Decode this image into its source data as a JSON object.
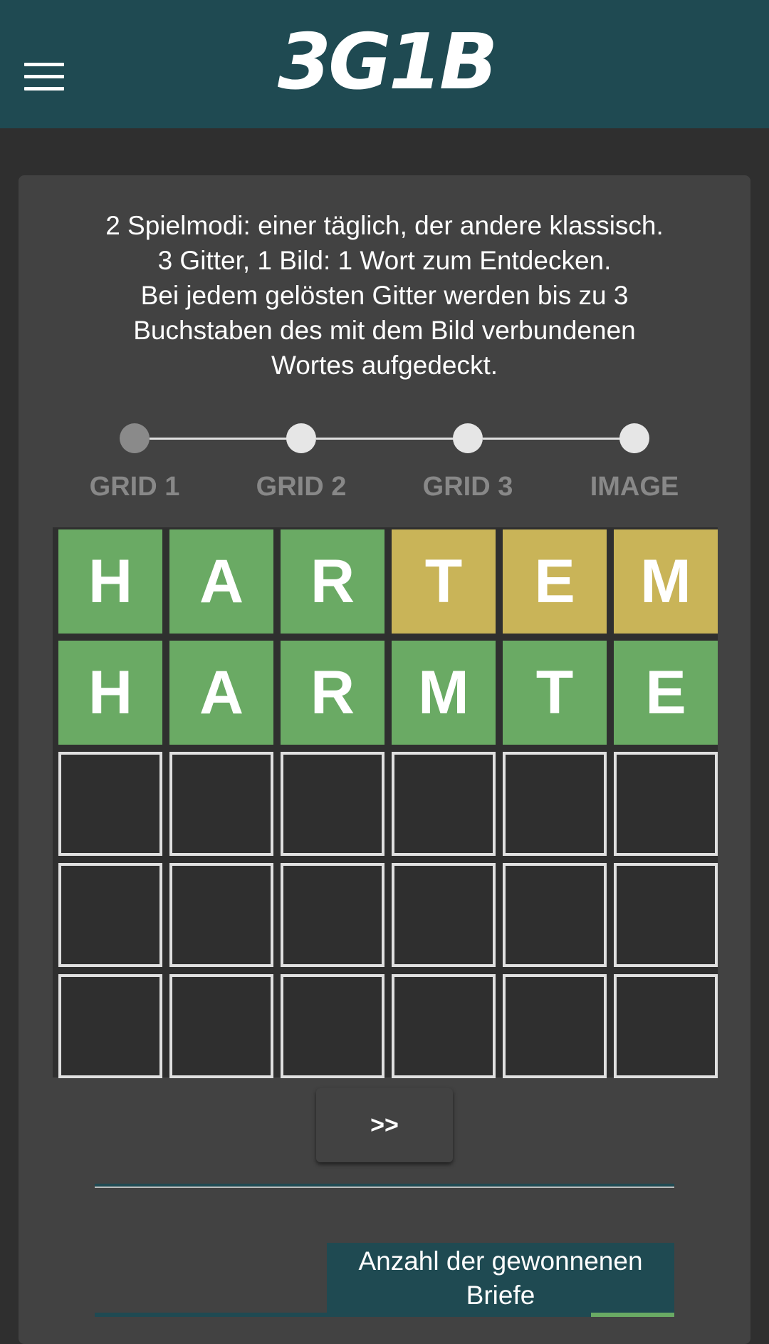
{
  "header": {
    "logo_text": "3G1B",
    "menu_icon": "hamburger-menu-icon"
  },
  "intro": {
    "lines": [
      "2 Spielmodi: einer täglich, der andere klassisch.",
      "3 Gitter, 1 Bild: 1 Wort zum Entdecken.",
      "Bei jedem gelösten Gitter werden bis zu 3",
      "Buchstaben des mit dem Bild verbundenen",
      "Wortes aufgedeckt."
    ]
  },
  "stepper": {
    "active_index": 0,
    "steps": [
      "GRID 1",
      "GRID 2",
      "GRID 3",
      "IMAGE"
    ]
  },
  "board": {
    "rows": [
      [
        {
          "letter": "H",
          "state": "green"
        },
        {
          "letter": "A",
          "state": "green"
        },
        {
          "letter": "R",
          "state": "green"
        },
        {
          "letter": "T",
          "state": "yellow"
        },
        {
          "letter": "E",
          "state": "yellow"
        },
        {
          "letter": "M",
          "state": "yellow"
        }
      ],
      [
        {
          "letter": "H",
          "state": "green"
        },
        {
          "letter": "A",
          "state": "green"
        },
        {
          "letter": "R",
          "state": "green"
        },
        {
          "letter": "M",
          "state": "green"
        },
        {
          "letter": "T",
          "state": "green"
        },
        {
          "letter": "E",
          "state": "green"
        }
      ],
      [
        {
          "letter": "",
          "state": "empty"
        },
        {
          "letter": "",
          "state": "empty"
        },
        {
          "letter": "",
          "state": "empty"
        },
        {
          "letter": "",
          "state": "empty"
        },
        {
          "letter": "",
          "state": "empty"
        },
        {
          "letter": "",
          "state": "empty"
        }
      ],
      [
        {
          "letter": "",
          "state": "empty"
        },
        {
          "letter": "",
          "state": "empty"
        },
        {
          "letter": "",
          "state": "empty"
        },
        {
          "letter": "",
          "state": "empty"
        },
        {
          "letter": "",
          "state": "empty"
        },
        {
          "letter": "",
          "state": "empty"
        }
      ],
      [
        {
          "letter": "",
          "state": "empty"
        },
        {
          "letter": "",
          "state": "empty"
        },
        {
          "letter": "",
          "state": "empty"
        },
        {
          "letter": "",
          "state": "empty"
        },
        {
          "letter": "",
          "state": "empty"
        },
        {
          "letter": "",
          "state": "empty"
        }
      ]
    ]
  },
  "next_button": {
    "label": ">>"
  },
  "stats": {
    "title_line1": "Anzahl der gewonnenen",
    "title_line2": "Briefe"
  },
  "colors": {
    "header_bg": "#1f4a52",
    "page_bg": "#2f2f2f",
    "card_bg": "#424242",
    "tile_green": "#6aaa64",
    "tile_yellow": "#c9b458",
    "step_inactive_text": "#888888"
  }
}
